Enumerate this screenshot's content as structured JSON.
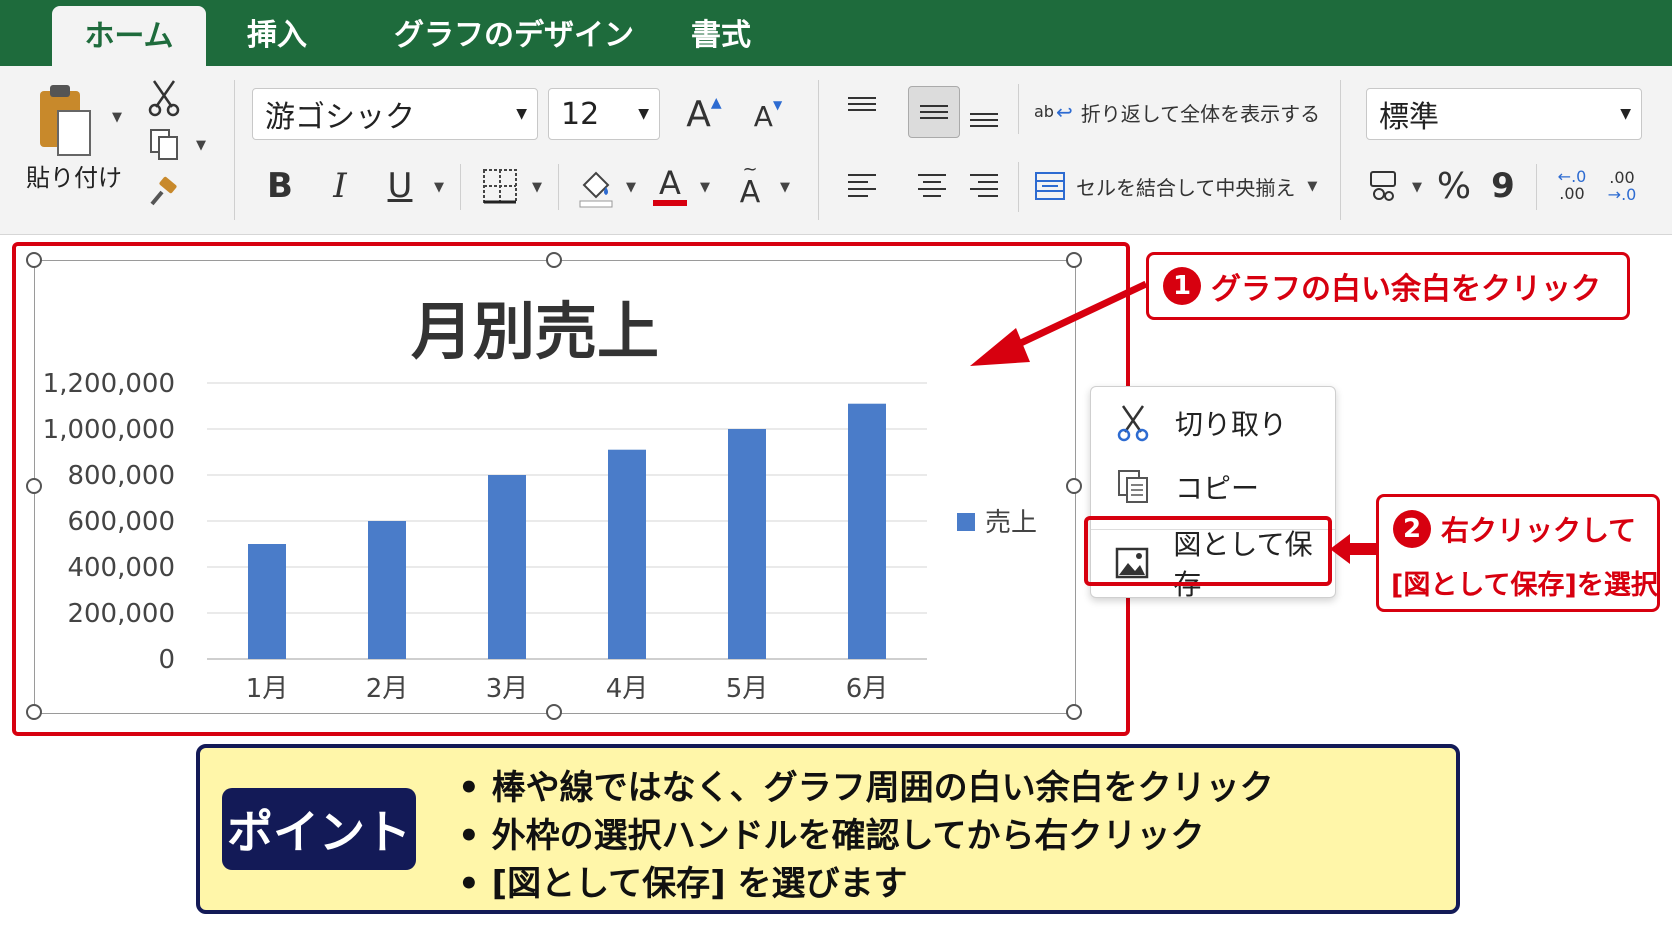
{
  "tabs": [
    {
      "label": "ホーム",
      "active": true
    },
    {
      "label": "挿入",
      "active": false
    },
    {
      "label": "グラフのデザイン",
      "active": false
    },
    {
      "label": "書式",
      "active": false
    }
  ],
  "clipboard": {
    "paste_label": "貼り付け"
  },
  "font": {
    "name": "游ゴシック",
    "size": "12",
    "bold": "B",
    "italic": "I",
    "underline": "U",
    "grow": "A",
    "shrink": "A",
    "font_color": "A",
    "phonetic": "A"
  },
  "alignment": {
    "wrap_label": "折り返して全体を表示する",
    "merge_label": "セルを結合して中央揃え",
    "wrap_icon_text": "ab"
  },
  "number": {
    "format": "標準",
    "percent": "%",
    "comma": "9",
    "inc_decimal": ".00",
    "dec_decimal": ".00"
  },
  "colors": {
    "accent_green": "#1e6b3c",
    "bar_blue": "#4a7cc9",
    "callout_red": "#d7000f",
    "point_navy": "#131a57",
    "point_yellow": "#fff6a9"
  },
  "chart_data": {
    "type": "bar",
    "title": "月別売上",
    "categories": [
      "1月",
      "2月",
      "3月",
      "4月",
      "5月",
      "6月"
    ],
    "series": [
      {
        "name": "売上",
        "values": [
          500000,
          600000,
          800000,
          910000,
          1000000,
          1110000
        ]
      }
    ],
    "ylim": [
      0,
      1200000
    ],
    "yticks": [
      "0",
      "200,000",
      "400,000",
      "600,000",
      "800,000",
      "1,000,000",
      "1,200,000"
    ],
    "grid": true,
    "legend": "right"
  },
  "callout1": {
    "number": "1",
    "text": "グラフの白い余白をクリック"
  },
  "context_menu": {
    "items": [
      {
        "label": "切り取り",
        "icon": "scissors-icon"
      },
      {
        "label": "コピー",
        "icon": "copy-icon"
      },
      {
        "label": "図として保存",
        "icon": "picture-icon"
      }
    ]
  },
  "callout2": {
    "number": "2",
    "line1": "右クリックして",
    "line2": "[図として保存]を選択"
  },
  "point": {
    "badge": "ポイント",
    "lines": [
      "• 棒や線ではなく、グラフ周囲の白い余白をクリック",
      "• 外枠の選択ハンドルを確認してから右クリック",
      "• [図として保存] を選びます"
    ]
  }
}
